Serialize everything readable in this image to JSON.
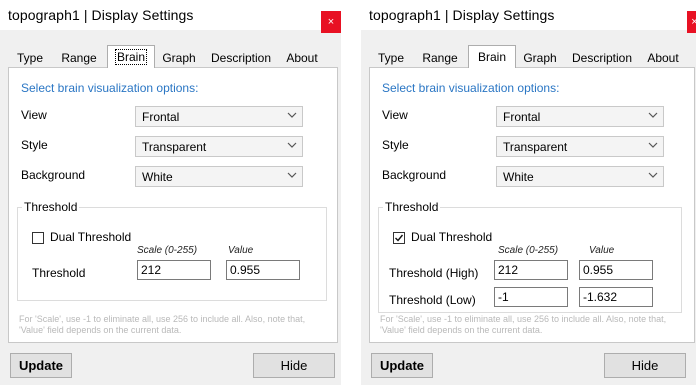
{
  "windows": [
    {
      "title": "topograph1 | Display Settings",
      "close_label": "×",
      "tabs": [
        "Type",
        "Range",
        "Brain",
        "Graph",
        "Description",
        "About"
      ],
      "active_tab": "Brain",
      "prompt": "Select brain visualization options:",
      "view": {
        "label": "View",
        "value": "Frontal"
      },
      "style": {
        "label": "Style",
        "value": "Transparent"
      },
      "background": {
        "label": "Background",
        "value": "White"
      },
      "threshold_group": "Threshold",
      "dual_threshold": {
        "label": "Dual Threshold",
        "checked": false
      },
      "scale_header": "Scale (0-255)",
      "value_header": "Value",
      "rows": [
        {
          "label": "Threshold",
          "scale": "212",
          "value": "0.955"
        }
      ],
      "hint": "For 'Scale', use -1 to eliminate all, use 256 to include all. Also, note that, 'Value' field depends on the current data.",
      "update_label": "Update",
      "hide_label": "Hide"
    },
    {
      "title": "topograph1 | Display Settings",
      "close_label": "×",
      "tabs": [
        "Type",
        "Range",
        "Brain",
        "Graph",
        "Description",
        "About"
      ],
      "active_tab": "Brain",
      "prompt": "Select brain visualization options:",
      "view": {
        "label": "View",
        "value": "Frontal"
      },
      "style": {
        "label": "Style",
        "value": "Transparent"
      },
      "background": {
        "label": "Background",
        "value": "White"
      },
      "threshold_group": "Threshold",
      "dual_threshold": {
        "label": "Dual Threshold",
        "checked": true
      },
      "scale_header": "Scale (0-255)",
      "value_header": "Value",
      "rows": [
        {
          "label": "Threshold (High)",
          "scale": "212",
          "value": "0.955"
        },
        {
          "label": "Threshold (Low)",
          "scale": "-1",
          "value": "-1.632"
        }
      ],
      "hint": "For 'Scale', use -1 to eliminate all, use 256 to include all. Also, note that, 'Value' field depends on the current data.",
      "update_label": "Update",
      "hide_label": "Hide"
    }
  ]
}
